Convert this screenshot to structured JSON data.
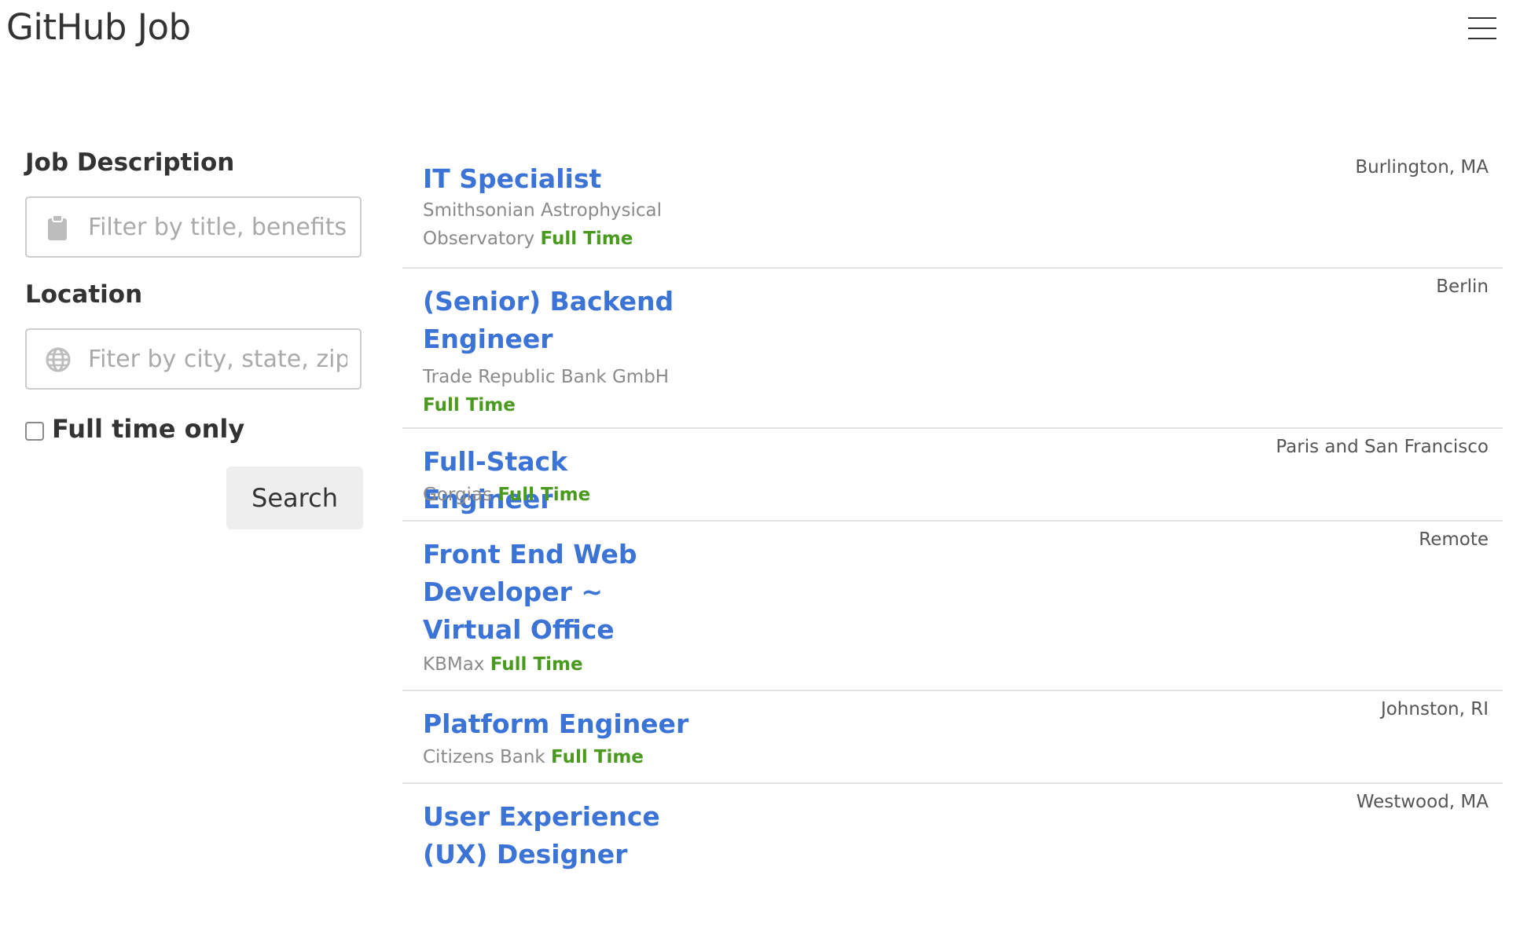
{
  "header": {
    "title": "GitHub Job",
    "menu_icon": "hamburger-menu-icon"
  },
  "filters": {
    "description_label": "Job Description",
    "description_placeholder": "Filter by title, benefits, companies, expertise",
    "description_icon": "clipboard-icon",
    "location_label": "Location",
    "location_placeholder": "Fiter by city, state, zip code or country",
    "location_icon": "globe-icon",
    "fulltime_label": "Full time only",
    "fulltime_checked": false,
    "search_label": "Search"
  },
  "jobs": [
    {
      "title": "IT Specialist",
      "company": "Smithsonian Astrophysical Observatory",
      "type": "Full Time",
      "location": "Burlington, MA"
    },
    {
      "title": "(Senior) Backend Engineer",
      "company": "Trade Republic Bank GmbH",
      "type": "Full Time",
      "location": "Berlin"
    },
    {
      "title": "Full-Stack Engineer",
      "company": "Gorgias",
      "type": "Full Time",
      "location": "Paris and San Francisco"
    },
    {
      "title": "Front End Web Developer ~ Virtual Office",
      "company": "KBMax",
      "type": "Full Time",
      "location": "Remote"
    },
    {
      "title": "Platform Engineer",
      "company": "Citizens Bank",
      "type": "Full Time",
      "location": "Johnston, RI"
    },
    {
      "title": "User Experience (UX) Designer",
      "company": "",
      "type": "",
      "location": "Westwood, MA"
    }
  ],
  "colors": {
    "title_link": "#3b73d6",
    "job_type": "#4a9a1f",
    "company": "#8a8a8a",
    "divider": "#e2e2e2"
  }
}
